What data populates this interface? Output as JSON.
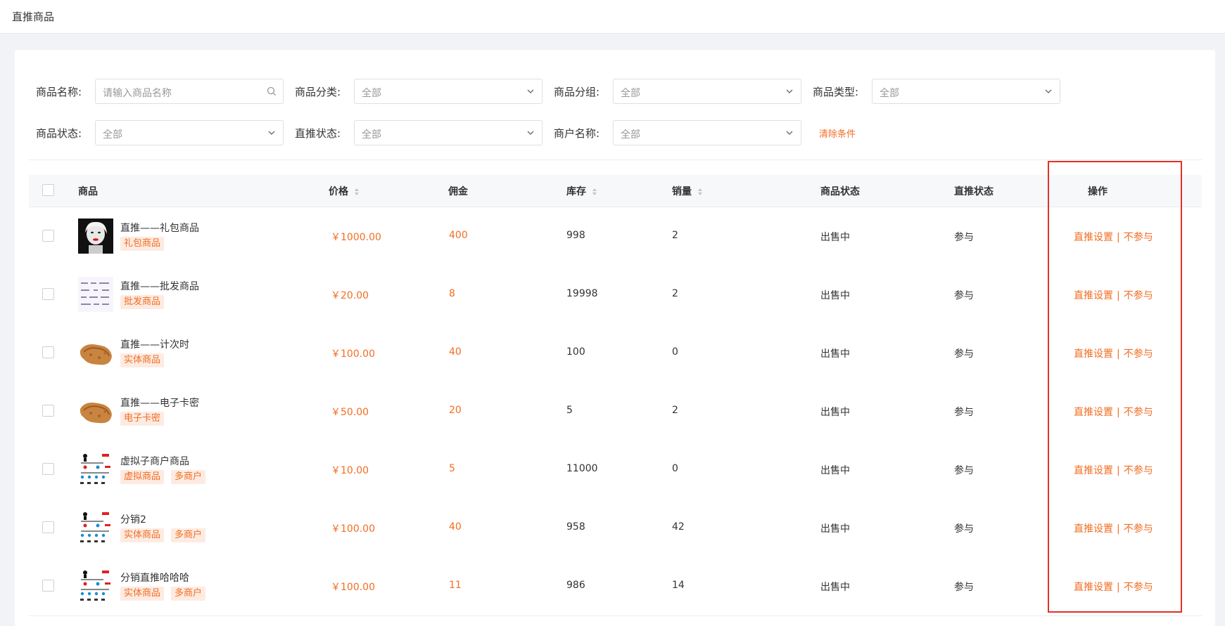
{
  "page": {
    "title": "直推商品"
  },
  "filters": {
    "name_label": "商品名称:",
    "name_placeholder": "请输入商品名称",
    "category_label": "商品分类:",
    "category_value": "全部",
    "group_label": "商品分组:",
    "group_value": "全部",
    "type_label": "商品类型:",
    "type_value": "全部",
    "status_label": "商品状态:",
    "status_value": "全部",
    "direct_label": "直推状态:",
    "direct_value": "全部",
    "merchant_label": "商户名称:",
    "merchant_value": "全部",
    "clear_label": "清除条件"
  },
  "table": {
    "headers": {
      "product": "商品",
      "price": "价格",
      "commission": "佣金",
      "stock": "库存",
      "sales": "销量",
      "status": "商品状态",
      "direct": "直推状态",
      "ops": "操作"
    },
    "op_setting": "直推设置",
    "op_separator": "|",
    "op_exclude": "不参与",
    "rows": [
      {
        "name": "直推——礼包商品",
        "tags": [
          "礼包商品"
        ],
        "price": "￥1000.00",
        "commission": "400",
        "stock": "998",
        "sales": "2",
        "status": "出售中",
        "direct": "参与",
        "thumb": "portrait"
      },
      {
        "name": "直推——批发商品",
        "tags": [
          "批发商品"
        ],
        "price": "￥20.00",
        "commission": "8",
        "stock": "19998",
        "sales": "2",
        "status": "出售中",
        "direct": "参与",
        "thumb": "doc"
      },
      {
        "name": "直推——计次时",
        "tags": [
          "实体商品"
        ],
        "price": "￥100.00",
        "commission": "40",
        "stock": "100",
        "sales": "0",
        "status": "出售中",
        "direct": "参与",
        "thumb": "food"
      },
      {
        "name": "直推——电子卡密",
        "tags": [
          "电子卡密"
        ],
        "price": "￥50.00",
        "commission": "20",
        "stock": "5",
        "sales": "2",
        "status": "出售中",
        "direct": "参与",
        "thumb": "food"
      },
      {
        "name": "虚拟子商户商品",
        "tags": [
          "虚拟商品",
          "多商户"
        ],
        "price": "￥10.00",
        "commission": "5",
        "stock": "11000",
        "sales": "0",
        "status": "出售中",
        "direct": "参与",
        "thumb": "tree"
      },
      {
        "name": "分销2",
        "tags": [
          "实体商品",
          "多商户"
        ],
        "price": "￥100.00",
        "commission": "40",
        "stock": "958",
        "sales": "42",
        "status": "出售中",
        "direct": "参与",
        "thumb": "tree"
      },
      {
        "name": "分销直推哈哈哈",
        "tags": [
          "实体商品",
          "多商户"
        ],
        "price": "￥100.00",
        "commission": "11",
        "stock": "986",
        "sales": "14",
        "status": "出售中",
        "direct": "参与",
        "thumb": "tree"
      }
    ]
  },
  "colors": {
    "accent": "#f26d22",
    "highlight": "#e03128"
  }
}
